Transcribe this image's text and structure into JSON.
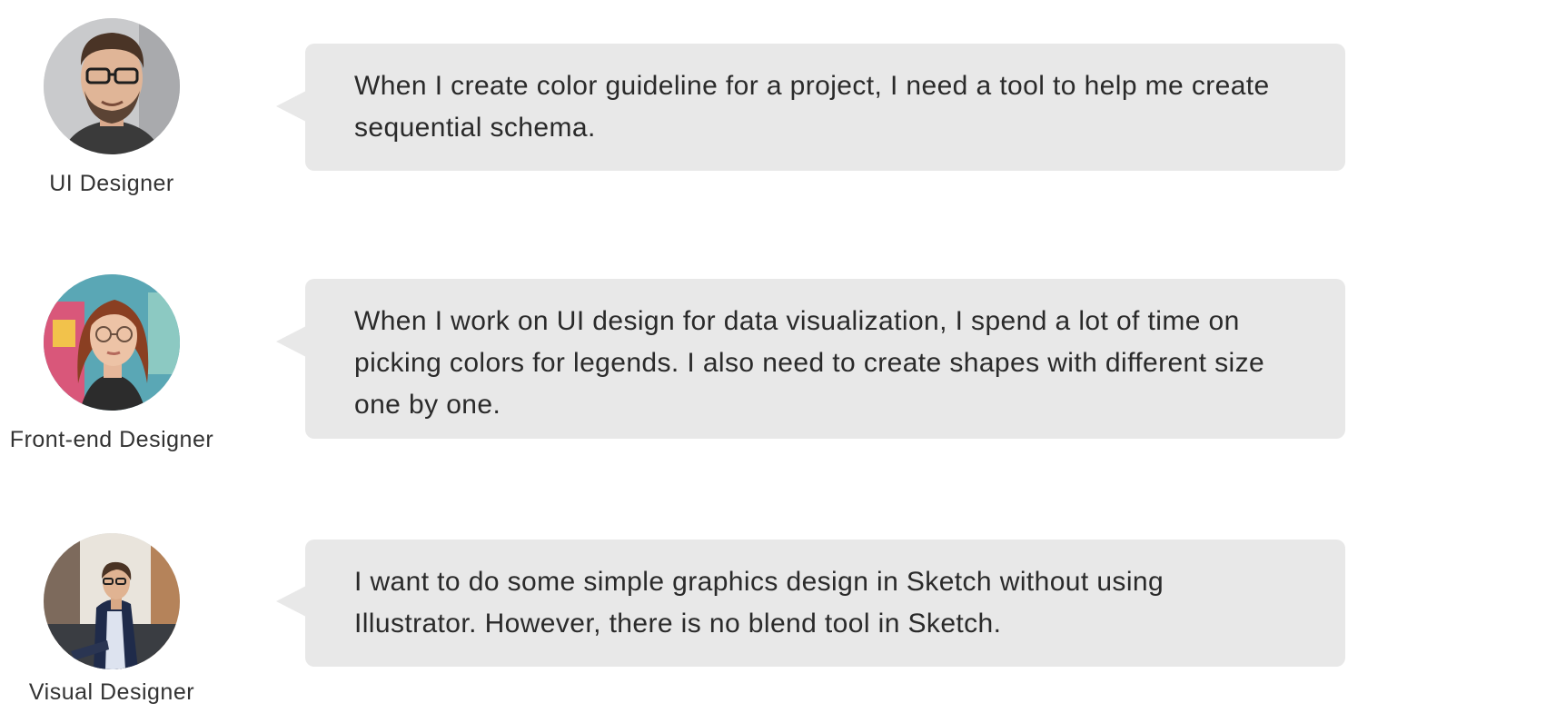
{
  "personas": [
    {
      "role": "UI Designer",
      "quote": "When I create color guideline for a project, I need a tool to help me create sequential schema.",
      "avatar_icon": "man-with-glasses-portrait"
    },
    {
      "role": "Front-end Designer",
      "quote": "When I work on UI design for data visualization, I spend a lot of time on picking colors for legends. I also need to create shapes with different size one by one.",
      "avatar_icon": "woman-with-glasses-portrait"
    },
    {
      "role": "Visual Designer",
      "quote": "I want to do some simple graphics design in Sketch without using Illustrator. However, there is no blend tool in Sketch.",
      "avatar_icon": "seated-man-portrait"
    }
  ],
  "colors": {
    "bubble_background": "#e8e8e8",
    "text": "#2a2a2a",
    "page_background": "#ffffff"
  }
}
